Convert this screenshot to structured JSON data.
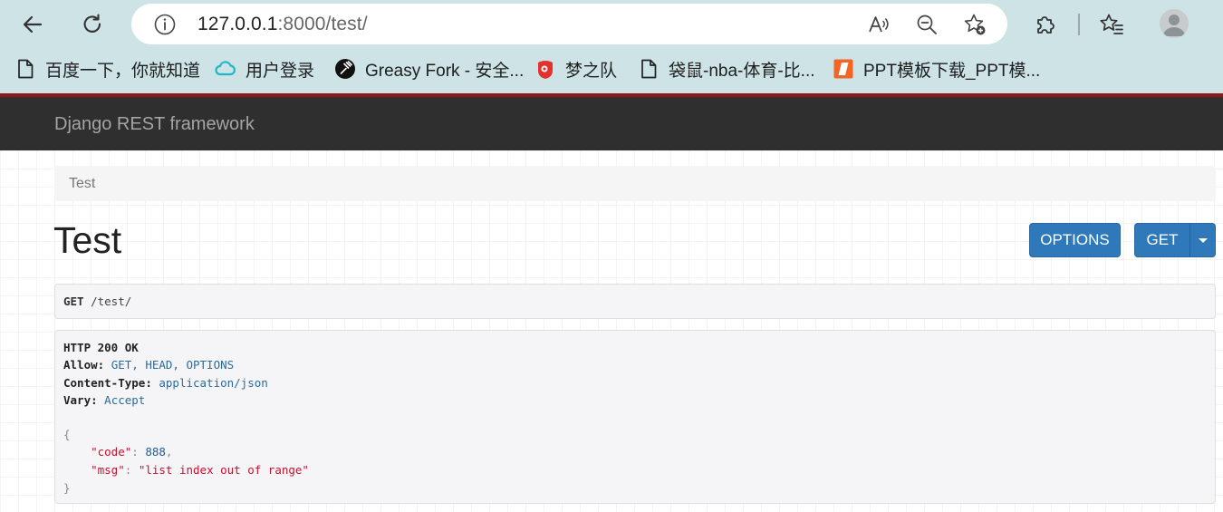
{
  "browser": {
    "url": {
      "host": "127.0.0.1",
      "rest": ":8000/test/"
    },
    "bookmarks": [
      {
        "label": "百度一下，你就知道",
        "icon": "page-icon"
      },
      {
        "label": "用户登录",
        "icon": "cloud-icon"
      },
      {
        "label": "Greasy Fork - 安全...",
        "icon": "greasyfork-icon"
      },
      {
        "label": "梦之队",
        "icon": "dreamteam-icon"
      },
      {
        "label": "袋鼠-nba-体育-比...",
        "icon": "page-icon"
      },
      {
        "label": "PPT模板下载_PPT模...",
        "icon": "ppt-icon"
      }
    ],
    "colors": {
      "chrome_bg": "#cde3e6",
      "accent_line": "#8c1a1a"
    }
  },
  "app": {
    "brand": "Django REST framework",
    "breadcrumb": "Test",
    "title": "Test",
    "buttons": {
      "options": "OPTIONS",
      "get": "GET"
    },
    "colors": {
      "navbar": "#2f2f2f",
      "button": "#2f78b9"
    }
  },
  "request": {
    "method": "GET",
    "path": "/test/"
  },
  "response": {
    "status_line": "HTTP 200 OK",
    "headers": [
      {
        "key": "Allow",
        "value": "GET, HEAD, OPTIONS"
      },
      {
        "key": "Content-Type",
        "value": "application/json"
      },
      {
        "key": "Vary",
        "value": "Accept"
      }
    ],
    "body": {
      "code_key": "\"code\"",
      "code_value": "888",
      "msg_key": "\"msg\"",
      "msg_value": "\"list index out of range\""
    }
  }
}
